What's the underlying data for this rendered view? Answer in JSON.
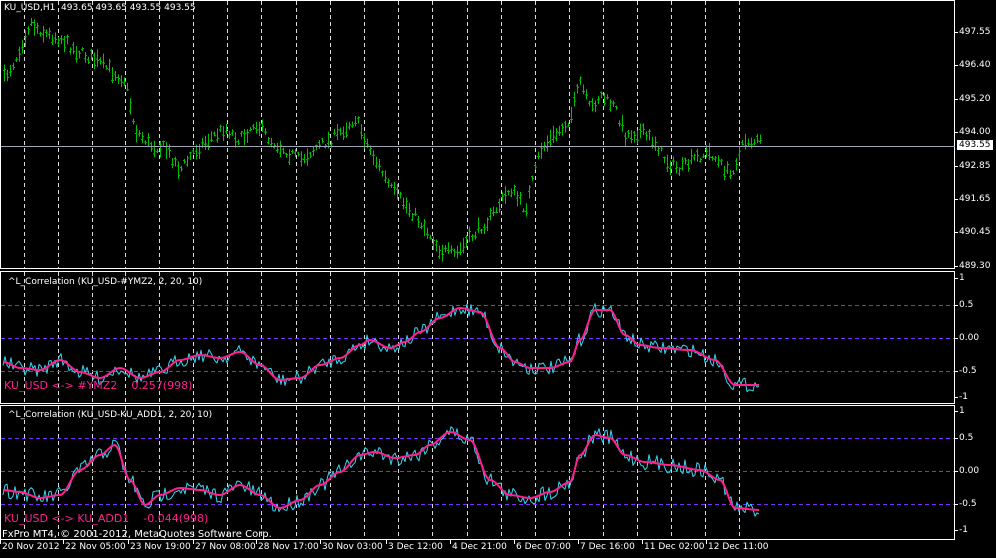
{
  "window": {
    "title": "KU_USD,H1  493.65 493.65 493.55 493.55"
  },
  "colors": {
    "background": "#000000",
    "price_bars": "#00c000",
    "grid": "#ffffff",
    "levels": "#7b2cff",
    "fast_line": "#33d7f2",
    "slow_line": "#ff1f8f",
    "current_price_line": "#9ea5b6",
    "frame": "#ffffff"
  },
  "main_pane": {
    "price_axis": [
      "497.55",
      "496.40",
      "495.20",
      "494.00",
      "492.85",
      "491.65",
      "490.45",
      "489.30"
    ],
    "current_price": "493.55"
  },
  "pane1": {
    "title": "^L_Correlation (KU_USD-#YMZ2, 2, 20, 10)",
    "label": "KU_USD <-> #YMZ2    0.257(998)",
    "axis": [
      "1",
      "0.5",
      "0.00",
      "-0.5",
      "-1"
    ]
  },
  "pane2": {
    "title": "^L_Correlation (KU_USD-KU_ADD1, 2, 20, 10)",
    "label": "KU_USD <-> KU_ADD1    -0.044(998)",
    "axis": [
      "1",
      "0.5",
      "0.00",
      "-0.5",
      "-1"
    ]
  },
  "footer": {
    "copyright": "FxPro MT4, © 2001-2012, MetaQuotes Software Corp."
  },
  "time_axis": [
    "20 Nov 2012",
    "22 Nov 05:00",
    "23 Nov 19:00",
    "27 Nov 08:00",
    "28 Nov 17:00",
    "30 Nov 03:00",
    "3 Dec 12:00",
    "4 Dec 21:00",
    "6 Dec 07:00",
    "7 Dec 16:00",
    "11 Dec 02:00",
    "12 Dec 11:00"
  ]
}
